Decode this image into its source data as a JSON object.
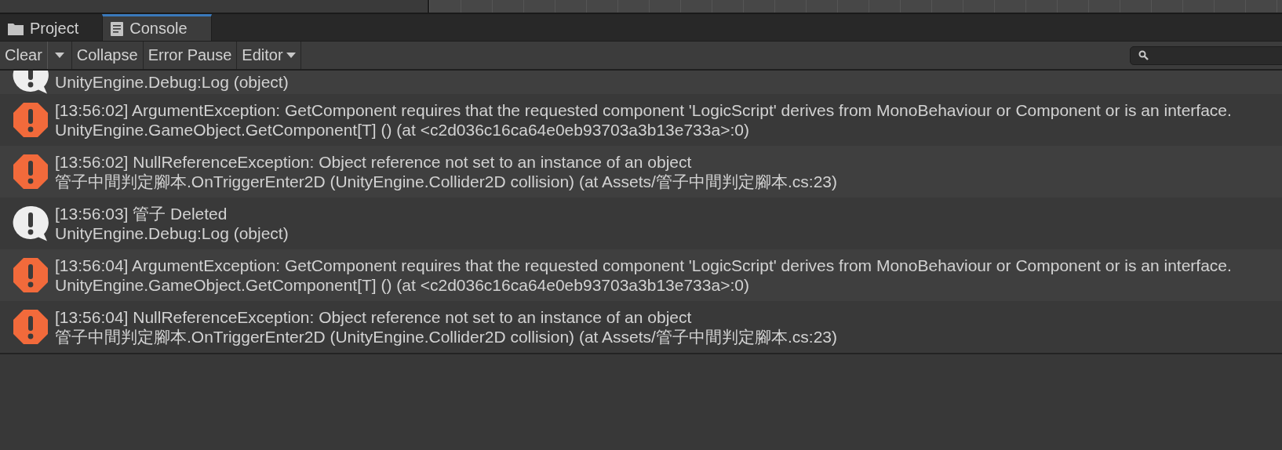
{
  "tabs": [
    {
      "label": "Project",
      "selected": false
    },
    {
      "label": "Console",
      "selected": true
    }
  ],
  "toolbar": {
    "buttons": [
      {
        "label": "Clear",
        "kind": "split"
      },
      {
        "label": "Collapse",
        "kind": "plain"
      },
      {
        "label": "Error Pause",
        "kind": "plain"
      },
      {
        "label": "Editor",
        "kind": "dropdown"
      }
    ]
  },
  "entries": [
    {
      "kind": "log",
      "partial": true,
      "lines": [
        "UnityEngine.Debug:Log (object)"
      ]
    },
    {
      "kind": "error",
      "partial": false,
      "lines": [
        "[13:56:02] ArgumentException: GetComponent requires that the requested component 'LogicScript' derives from MonoBehaviour or Component or is an interface.",
        "UnityEngine.GameObject.GetComponent[T] () (at <c2d036c16ca64e0eb93703a3b13e733a>:0)"
      ]
    },
    {
      "kind": "error",
      "partial": false,
      "lines": [
        "[13:56:02] NullReferenceException: Object reference not set to an instance of an object",
        "管子中間判定腳本.OnTriggerEnter2D (UnityEngine.Collider2D collision) (at Assets/管子中間判定腳本.cs:23)"
      ]
    },
    {
      "kind": "log",
      "partial": false,
      "lines": [
        "[13:56:03] 管子 Deleted",
        "UnityEngine.Debug:Log (object)"
      ]
    },
    {
      "kind": "error",
      "partial": false,
      "lines": [
        "[13:56:04] ArgumentException: GetComponent requires that the requested component 'LogicScript' derives from MonoBehaviour or Component or is an interface.",
        "UnityEngine.GameObject.GetComponent[T] () (at <c2d036c16ca64e0eb93703a3b13e733a>:0)"
      ]
    },
    {
      "kind": "error",
      "partial": false,
      "lines": [
        "[13:56:04] NullReferenceException: Object reference not set to an instance of an object",
        "管子中間判定腳本.OnTriggerEnter2D (UnityEngine.Collider2D collision) (at Assets/管子中間判定腳本.cs:23)"
      ]
    }
  ]
}
